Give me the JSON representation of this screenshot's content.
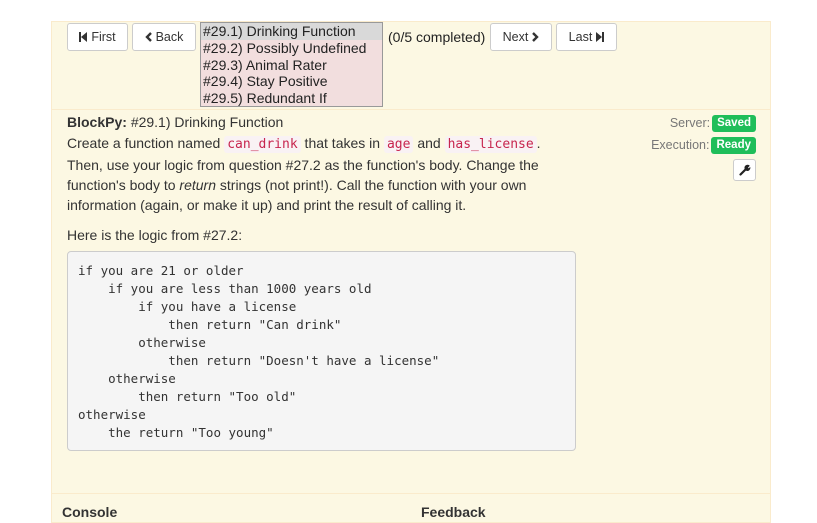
{
  "nav": {
    "first_label": "First",
    "back_label": "Back",
    "next_label": "Next",
    "last_label": "Last",
    "progress_text": "(0/5 completed)",
    "questions": [
      {
        "label": "#29.1) Drinking Function",
        "selected": true
      },
      {
        "label": "#29.2) Possibly Undefined",
        "selected": false
      },
      {
        "label": "#29.3) Animal Rater",
        "selected": false
      },
      {
        "label": "#29.4) Stay Positive",
        "selected": false
      },
      {
        "label": "#29.5) Redundant If",
        "selected": false
      }
    ]
  },
  "assignment": {
    "brand": "BlockPy:",
    "title": "#29.1) Drinking Function",
    "desc_part1": "Create a function named ",
    "code1": "can_drink",
    "desc_part2": " that takes in ",
    "code2": "age",
    "desc_part3": " and ",
    "code3": "has_license",
    "desc_part4": ". Then, use your logic from question #27.2 as the function's body. Change the function's body to ",
    "desc_em": "return",
    "desc_part5": " strings (not print!). Call the function with your own information (again, or make it up) and print the result of calling it.",
    "logic_intro": "Here is the logic from #27.2:",
    "logic_code": "if you are 21 or older\n    if you are less than 1000 years old\n        if you have a license\n            then return \"Can drink\"\n        otherwise\n            then return \"Doesn't have a license\"\n    otherwise\n        then return \"Too old\"\notherwise\n    the return \"Too young\""
  },
  "status": {
    "server_label": "Server:",
    "server_value": "Saved",
    "execution_label": "Execution:",
    "execution_value": "Ready",
    "badge_color": "#1fbe5a"
  },
  "footer": {
    "console_label": "Console",
    "feedback_label": "Feedback"
  }
}
